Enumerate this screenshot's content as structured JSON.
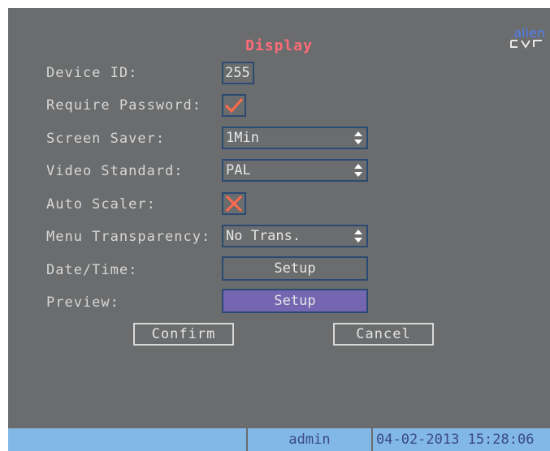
{
  "screen": {
    "title": "Display",
    "logo": {
      "line1": "alien",
      "line2": "DVR"
    }
  },
  "form": {
    "device_id_label": "Device ID:",
    "device_id_value": "255",
    "require_password_label": "Require Password:",
    "require_password_checked": true,
    "screen_saver_label": "Screen Saver:",
    "screen_saver_value": "1Min",
    "video_standard_label": "Video Standard:",
    "video_standard_value": "PAL",
    "auto_scaler_label": "Auto Scaler:",
    "auto_scaler_checked": false,
    "menu_transparency_label": "Menu Transparency:",
    "menu_transparency_value": "No Trans.",
    "datetime_label": "Date/Time:",
    "datetime_button": "Setup",
    "preview_label": "Preview:",
    "preview_button": "Setup"
  },
  "actions": {
    "confirm": "Confirm",
    "cancel": "Cancel"
  },
  "status_bar": {
    "user": "admin",
    "datetime": "04-02-2013 15:28:06"
  },
  "colors": {
    "background": "#6b6c6d",
    "title": "#ff6b78",
    "check_mark": "#ff6a4a",
    "field_border": "#2b4a73",
    "selected_button": "#7466b0",
    "status_bar": "#82b8e6"
  },
  "icons": {
    "checked": "checkmark-icon",
    "unchecked": "x-mark-icon",
    "spinner": "up-down-arrows-icon"
  }
}
